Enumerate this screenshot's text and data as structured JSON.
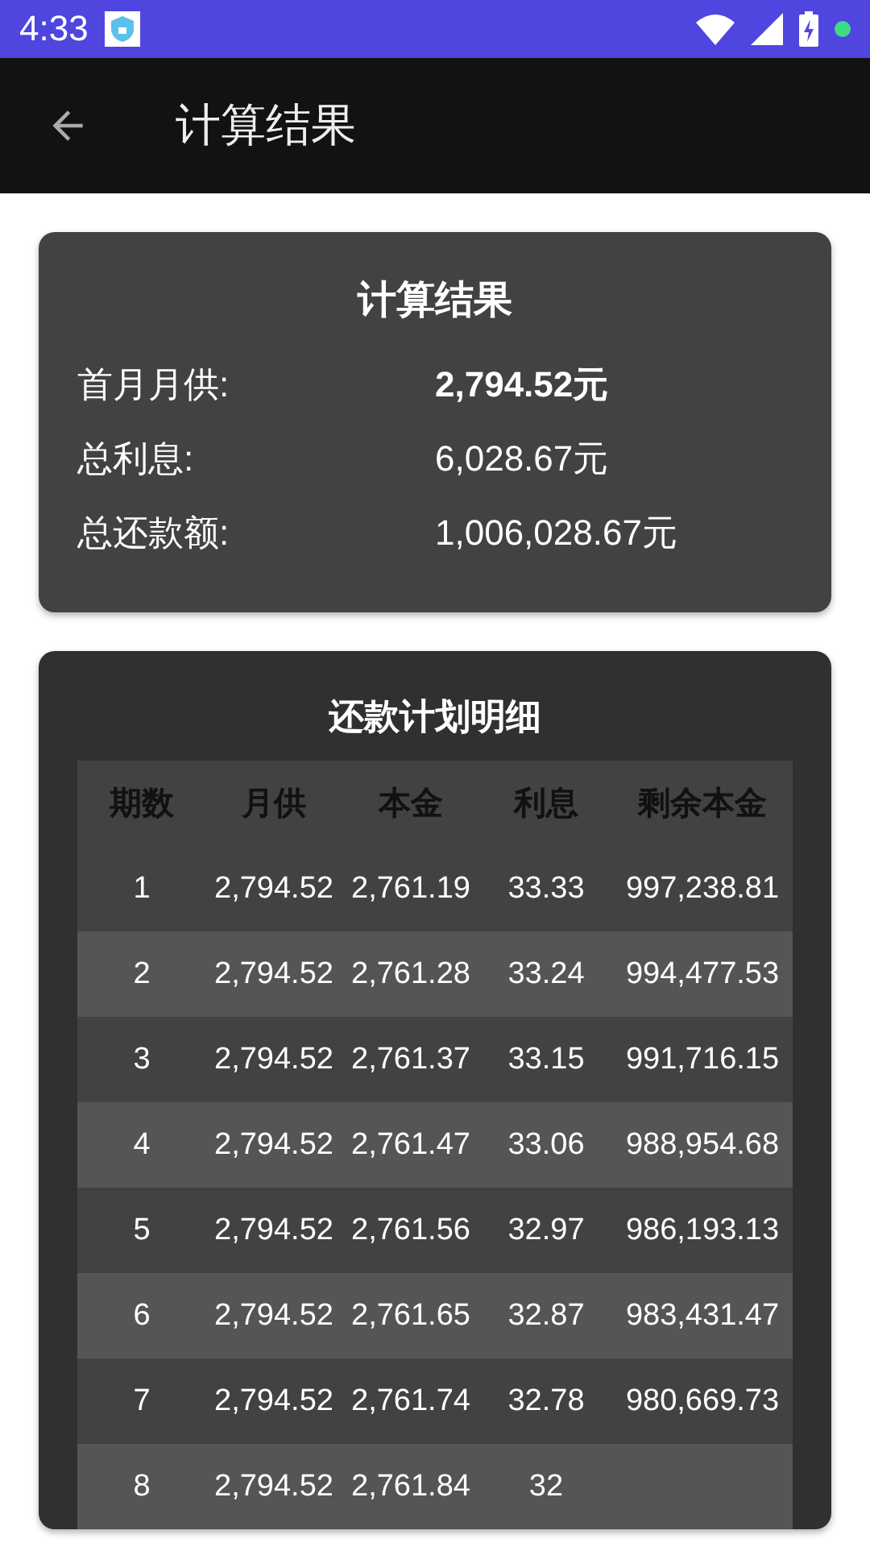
{
  "status_bar": {
    "time": "4:33"
  },
  "app_bar": {
    "title": "计算结果"
  },
  "summary": {
    "title": "计算结果",
    "rows": [
      {
        "label": "首月月供:",
        "value": "2,794.52元",
        "emphasized": true
      },
      {
        "label": "总利息:",
        "value": "6,028.67元",
        "emphasized": false
      },
      {
        "label": "总还款额:",
        "value": "1,006,028.67元",
        "emphasized": false
      }
    ]
  },
  "schedule": {
    "title": "还款计划明细",
    "columns": [
      "期数",
      "月供",
      "本金",
      "利息",
      "剩余本金"
    ],
    "rows": [
      [
        "1",
        "2,794.52",
        "2,761.19",
        "33.33",
        "997,238.81"
      ],
      [
        "2",
        "2,794.52",
        "2,761.28",
        "33.24",
        "994,477.53"
      ],
      [
        "3",
        "2,794.52",
        "2,761.37",
        "33.15",
        "991,716.15"
      ],
      [
        "4",
        "2,794.52",
        "2,761.47",
        "33.06",
        "988,954.68"
      ],
      [
        "5",
        "2,794.52",
        "2,761.56",
        "32.97",
        "986,193.13"
      ],
      [
        "6",
        "2,794.52",
        "2,761.65",
        "32.87",
        "983,431.47"
      ],
      [
        "7",
        "2,794.52",
        "2,761.74",
        "32.78",
        "980,669.73"
      ],
      [
        "8",
        "2,794.52",
        "2,761.84",
        "32"
      ]
    ]
  }
}
